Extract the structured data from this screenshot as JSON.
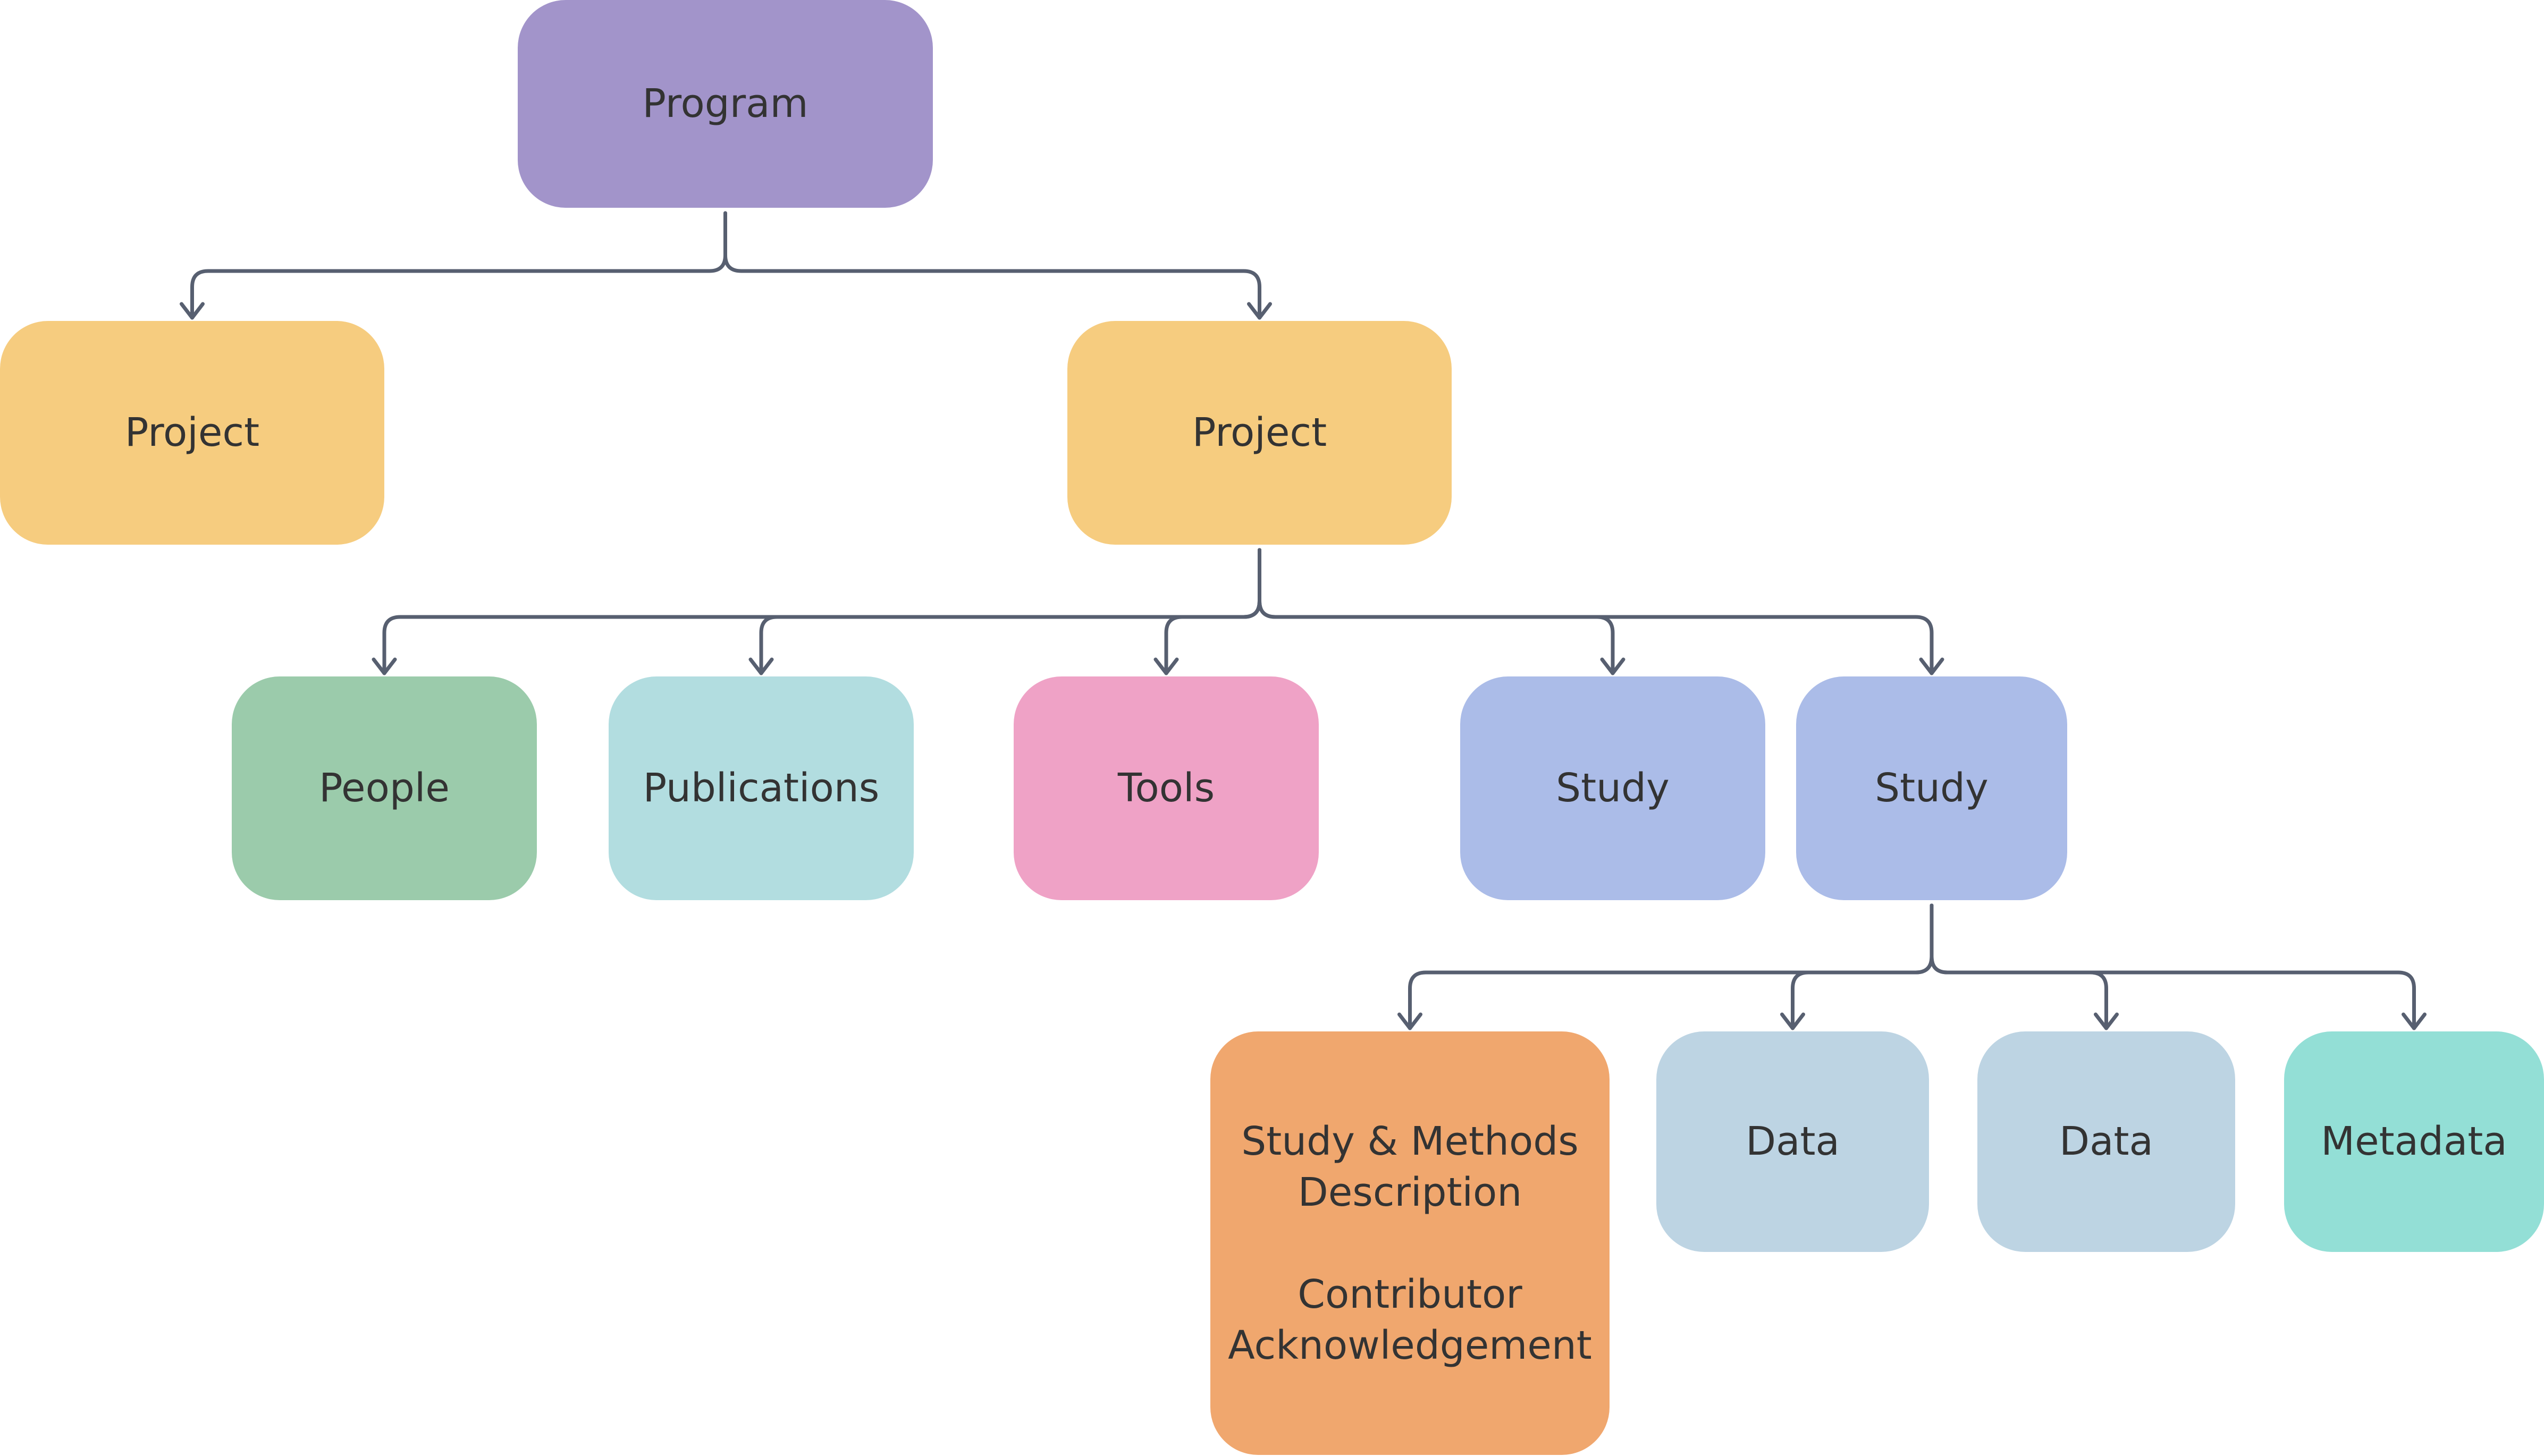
{
  "diagram": {
    "type": "hierarchy",
    "connector_color": "#575f70",
    "text_color": "#333333",
    "nodes": {
      "program": {
        "label": "Program",
        "color": "#a294ca"
      },
      "project_left": {
        "label": "Project",
        "color": "#f6cc7f"
      },
      "project_right": {
        "label": "Project",
        "color": "#f6cc7f"
      },
      "people": {
        "label": "People",
        "color": "#9bcbab"
      },
      "publications": {
        "label": "Publications",
        "color": "#b2dde0"
      },
      "tools": {
        "label": "Tools",
        "color": "#efa2c6"
      },
      "study_1": {
        "label": "Study",
        "color": "#abbce8"
      },
      "study_2": {
        "label": "Study",
        "color": "#abbce8"
      },
      "methods": {
        "label": "Study & Methods\nDescription\n\nContributor\nAcknowledgement",
        "color": "#f0a76e"
      },
      "data_1": {
        "label": "Data",
        "color": "#bdd4e3"
      },
      "data_2": {
        "label": "Data",
        "color": "#bdd4e3"
      },
      "metadata": {
        "label": "Metadata",
        "color": "#93dfd6"
      }
    },
    "edges": [
      [
        "program",
        "project_left"
      ],
      [
        "program",
        "project_right"
      ],
      [
        "project_right",
        "people"
      ],
      [
        "project_right",
        "publications"
      ],
      [
        "project_right",
        "tools"
      ],
      [
        "project_right",
        "study_1"
      ],
      [
        "project_right",
        "study_2"
      ],
      [
        "study_2",
        "methods"
      ],
      [
        "study_2",
        "data_1"
      ],
      [
        "study_2",
        "data_2"
      ],
      [
        "study_2",
        "metadata"
      ]
    ]
  }
}
